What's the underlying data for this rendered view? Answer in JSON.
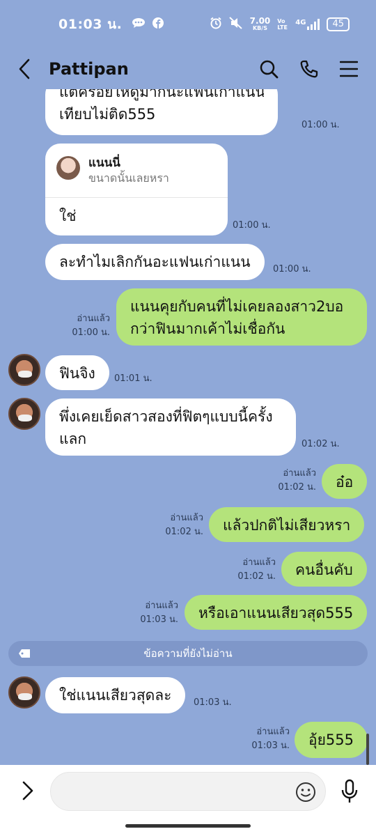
{
  "status_bar": {
    "time": "01:03 น.",
    "net_speed_value": "7.00",
    "net_speed_unit": "KB/S",
    "volte": "Vo LTE",
    "signal": "4G",
    "battery": "45"
  },
  "header": {
    "title": "Pattipan"
  },
  "messages": [
    {
      "side": "in",
      "text": "แต่ครอยให้ดูมากนะแฟนเก่าแนนน",
      "text2": "เทียบไม่ติด555",
      "time": "01:00 น."
    },
    {
      "side": "in",
      "reply_name": "แนนนี่",
      "reply_text": "ขนาดนั้นเลยหรา",
      "text": "ใช่",
      "time": "01:00 น."
    },
    {
      "side": "in",
      "text": "ละทำไมเลิกกันอะแฟนเก่าแนน",
      "time": "01:00 น."
    },
    {
      "side": "out",
      "read": "อ่านแล้ว",
      "text": "แนนคุยกับคนที่ไม่เคยลองสาว2บอ",
      "text2": "กว่าฟินมากเค้าไม่เชื่อกัน",
      "time": "01:00 น."
    },
    {
      "side": "in",
      "text": "ฟินจิง",
      "time": "01:01 น."
    },
    {
      "side": "in",
      "text": "พึ่งเคยเย็ดสาวสองที่ฟิตๆแบบนี้ครั้ง",
      "text2": "แลก",
      "time": "01:02 น."
    },
    {
      "side": "out",
      "read": "อ่านแล้ว",
      "text": "อ๋อ",
      "time": "01:02 น."
    },
    {
      "side": "out",
      "read": "อ่านแล้ว",
      "text": "แล้วปกติไม่เสียวหรา",
      "time": "01:02 น."
    },
    {
      "side": "out",
      "read": "อ่านแล้ว",
      "text": "คนอื่นคับ",
      "time": "01:02 น."
    },
    {
      "side": "out",
      "read": "อ่านแล้ว",
      "text": "หรือเอาแนนเสียวสุด555",
      "time": "01:03 น."
    },
    {
      "side": "in",
      "text": "ใช่แนนเสียวสุดละ",
      "time": "01:03 น."
    },
    {
      "side": "out",
      "read": "อ่านแล้ว",
      "text": "อุ้ย555",
      "time": "01:03 น."
    }
  ],
  "unread_divider": "ข้อความที่ยังไม่อ่าน",
  "input": {
    "placeholder": ""
  },
  "icons": {
    "back": "chevron-left-icon",
    "search": "search-icon",
    "call": "phone-icon",
    "menu": "hamburger-menu-icon",
    "expand": "chevron-right-icon",
    "emoji": "smiley-icon",
    "mic": "microphone-icon"
  },
  "colors": {
    "background": "#8fa8d8",
    "outgoing_bubble": "#b4e37b",
    "incoming_bubble": "#ffffff"
  }
}
